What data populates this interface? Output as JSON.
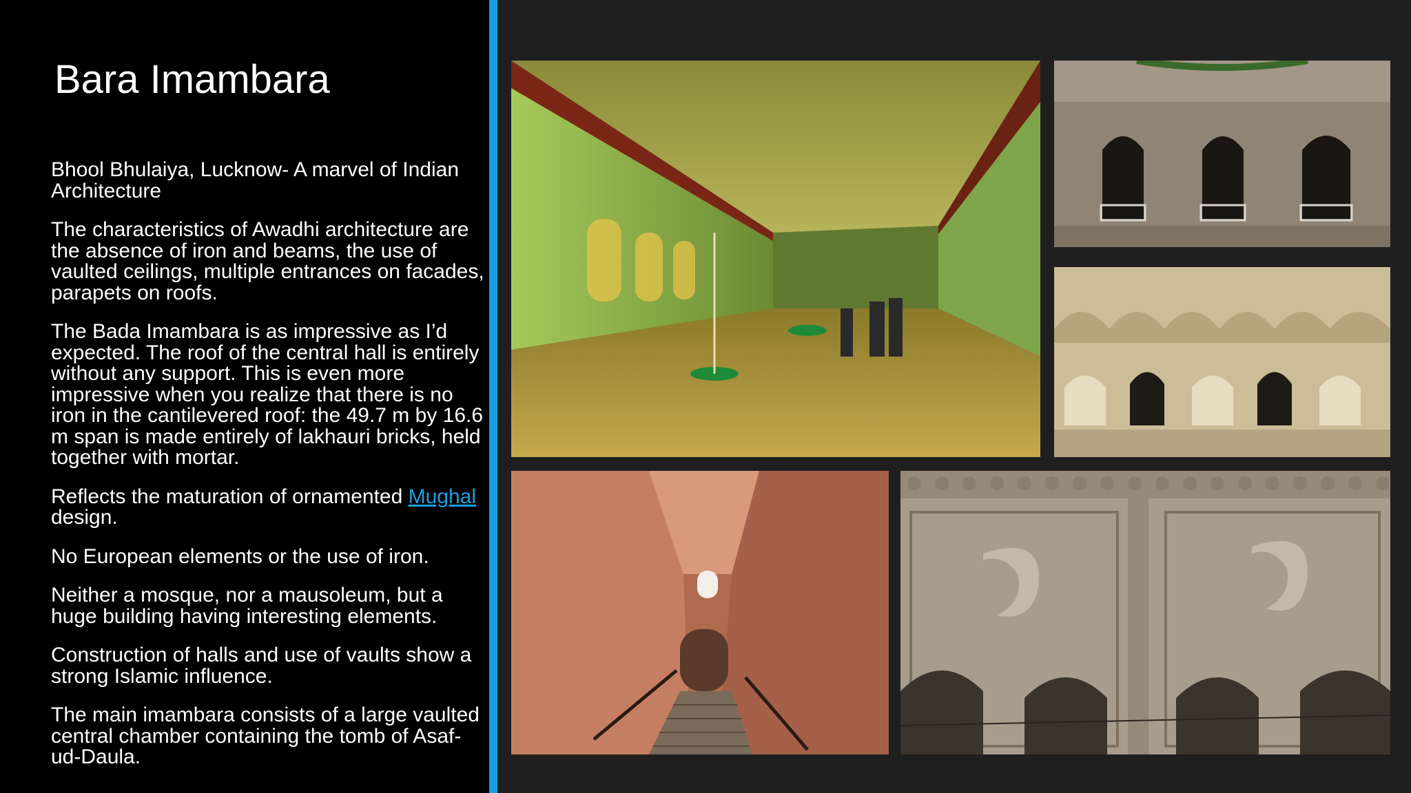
{
  "slide": {
    "title": "Bara Imambara",
    "paragraphs": {
      "p1": "Bhool Bhulaiya, Lucknow- A marvel of Indian Architecture",
      "p2": "The characteristics of Awadhi architecture are the absence of iron and beams, the use of vaulted ceilings, multiple entrances on facades, parapets on roofs.",
      "p3": "The Bada Imambara is as impressive as I’d expected. The roof of the central hall is entirely without any support. This is even more impressive when you realize that there is no iron in the cantilevered roof: the 49.7 m by 16.6 m span is made entirely of lakhauri bricks, held together with mortar.",
      "p4_before": "Reflects the maturation of ornamented ",
      "p4_link": "Mughal",
      "p4_after": " design.",
      "p5": "No European elements or the use of iron.",
      "p6": " Neither a mosque, nor a mausoleum, but a huge building having interesting elements.",
      "p7": " Construction of halls and use of vaults show a strong Islamic influence.",
      "p8": "The main imambara consists of a large vaulted central chamber containing the tomb of Asaf-ud-Daula."
    }
  },
  "colors": {
    "accent": "#1aa0e0",
    "left_background": "#000000",
    "right_background": "#1f1f1f",
    "text": "#ffffff"
  }
}
